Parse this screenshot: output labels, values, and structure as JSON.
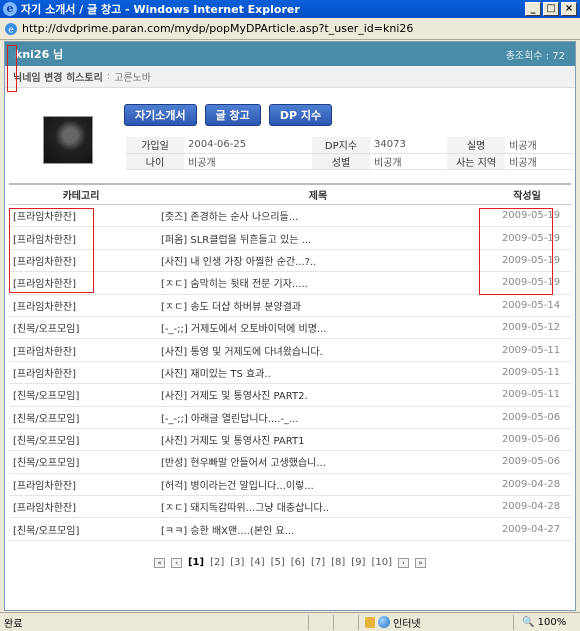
{
  "window": {
    "title": "자기 소개서 / 글 창고 - Windows Internet Explorer",
    "url": "http://dvdprime.paran.com/mydp/popMyDPArticle.asp?t_user_id=kni26"
  },
  "header": {
    "user": "kni26 님",
    "visits": "총조회수 : 72"
  },
  "history": {
    "label": "닉네임 변경 히스토리",
    "separator": ":",
    "value": "고른노바"
  },
  "buttons": {
    "intro": "자기소개서",
    "articles": "글 창고",
    "dp_index": "DP 지수"
  },
  "profile": {
    "join_label": "가입일",
    "join_value": "2004-06-25",
    "dp_label": "DP지수",
    "dp_value": "34073",
    "realname_label": "실명",
    "realname_value": "비공개",
    "age_label": "나이",
    "age_value": "비공개",
    "gender_label": "성별",
    "gender_value": "비공개",
    "region_label": "사는 지역",
    "region_value": "비공개"
  },
  "list": {
    "headers": {
      "category": "카테고리",
      "subject": "제목",
      "date": "작성일"
    },
    "rows": [
      {
        "category": "[프라임차한잔]",
        "subject": "[즛즈] 존경하는 순사 나으리들...",
        "date": "2009-05-19"
      },
      {
        "category": "[프라임차한잔]",
        "subject": "[퍼옴] SLR클럽을 뒤흔들고 있는 ...",
        "date": "2009-05-19"
      },
      {
        "category": "[프라임차한잔]",
        "subject": "[사진] 내 인생 가장 아찔한 순간...?..",
        "date": "2009-05-19"
      },
      {
        "category": "[프라임차한잔]",
        "subject": "[ㅈㄷ] 숨막히는 뒷태 전문 기자.....",
        "date": "2009-05-19"
      },
      {
        "category": "[프라임차한잔]",
        "subject": "[ㅈㄷ] 송도 더샵 하버뷰 분양결과",
        "date": "2009-05-14"
      },
      {
        "category": "[친목/오프모임]",
        "subject": "[-_-;;] 거제도에서 오토바이덕에 비명...",
        "date": "2009-05-12"
      },
      {
        "category": "[프라임차한잔]",
        "subject": "[사진] 통영 및 거제도에 다녀왔습니다.",
        "date": "2009-05-11"
      },
      {
        "category": "[프라임차한잔]",
        "subject": "[사진] 재미있는 TS 효과..",
        "date": "2009-05-11"
      },
      {
        "category": "[친목/오프모임]",
        "subject": "[사진] 거제도 및 통영사진 PART2.",
        "date": "2009-05-11"
      },
      {
        "category": "[친목/오프모임]",
        "subject": "[-_-;;] 아래글 열린답니다....-_...",
        "date": "2009-05-06"
      },
      {
        "category": "[친목/오프모임]",
        "subject": "[사진] 거제도 및 통영사진 PART1",
        "date": "2009-05-06"
      },
      {
        "category": "[친목/오프모임]",
        "subject": "[반성] 현우빠말 안들어서 고생했습니...",
        "date": "2009-05-06"
      },
      {
        "category": "[프라임차한잔]",
        "subject": "[허걱] 병이라는건 말입니다...이렇...",
        "date": "2009-04-28"
      },
      {
        "category": "[프라임차한잔]",
        "subject": "[ㅈㄷ] 돼지독감따위...그냥 대충삽니다..",
        "date": "2009-04-28"
      },
      {
        "category": "[친목/오프모임]",
        "subject": "[ㅋㅋ] 승한 배X맨....(본인 요...",
        "date": "2009-04-27"
      }
    ]
  },
  "pager": {
    "first": "«",
    "prev": "‹",
    "next": "›",
    "last": "»",
    "pages": [
      "[1]",
      "[2]",
      "[3]",
      "[4]",
      "[5]",
      "[6]",
      "[7]",
      "[8]",
      "[9]",
      "[10]"
    ],
    "current": 1
  },
  "status": {
    "text": "완료",
    "zone": "인터넷",
    "zoom": "100%"
  },
  "colors": {
    "header_bar": "#4a8ba7",
    "button": "#2c57b0",
    "highlight": "#d92020"
  }
}
